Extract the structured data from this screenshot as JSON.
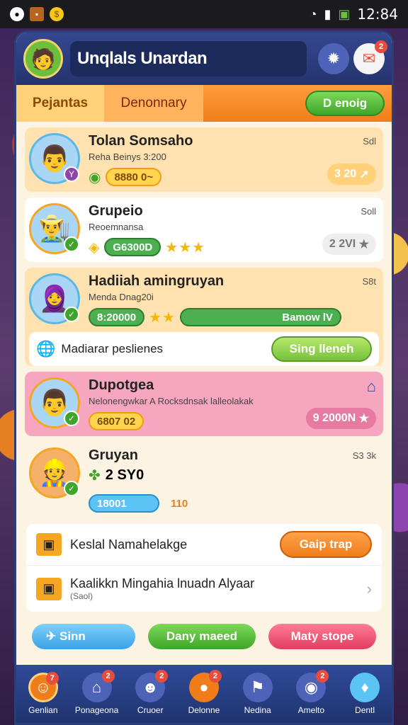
{
  "status": {
    "time": "12:84"
  },
  "header": {
    "title": "Unqlals Unardan",
    "mail_badge": "2"
  },
  "tabs": {
    "tab1": "Pejantas",
    "tab2": "Denonnary",
    "green_button": "D enoig"
  },
  "cards": [
    {
      "name": "Tolan Somsaho",
      "sub": "Reha Beinys 3:200",
      "top_right": "Sdl",
      "pill": "8880 0~",
      "right_pill": "3 20"
    },
    {
      "name": "Grupeio",
      "sub": "Reoemnansa",
      "top_right": "Soll",
      "pill": "G6300D",
      "right_pill": "2 2VI"
    },
    {
      "name": "Hadiiah amingruyan",
      "sub": "Menda Dnag20i",
      "top_right": "S8t",
      "pill": "8:20000",
      "green_pill": "Bamow lV",
      "row_label": "Madiarar peslienes",
      "row_button": "Sing lleneh"
    },
    {
      "name": "Dupotgea",
      "sub": "Nelonengwkar A Rocksdnsak lalleolakak",
      "pill": "6807 02",
      "right_pill": "9 2000N"
    },
    {
      "name": "Gruyan",
      "sub": "",
      "top_right": "S3 3k",
      "value": "2 SY0",
      "pill": "18001",
      "pill2": "110"
    }
  ],
  "bottom": {
    "row1": "Keslal Namahelakge",
    "row1_button": "Gaip trap",
    "row2": "Kaalikkn Mingahia lnuadn Alyaar",
    "row2_sub": "(Saol)"
  },
  "actions": {
    "a1": "Sinn",
    "a2": "Dany maeed",
    "a3": "Maty stope"
  },
  "nav": [
    {
      "label": "Genlian",
      "badge": "7"
    },
    {
      "label": "Ponageona",
      "badge": "2"
    },
    {
      "label": "Cruoer",
      "badge": "2"
    },
    {
      "label": "Delonne",
      "badge": "2"
    },
    {
      "label": "Nedina",
      "badge": ""
    },
    {
      "label": "Amelto",
      "badge": "2"
    },
    {
      "label": "Dentl",
      "badge": ""
    }
  ]
}
